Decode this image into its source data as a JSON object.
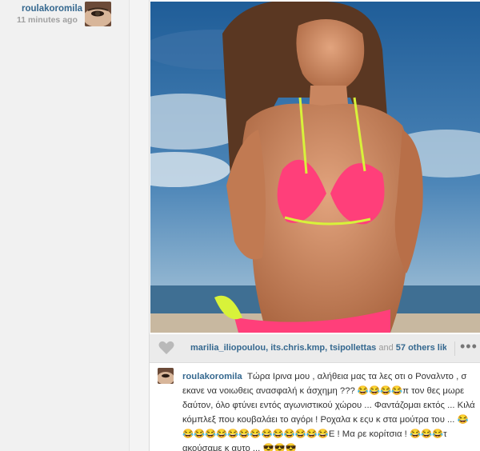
{
  "post": {
    "username": "roulakoromila",
    "time": "11 minutes ago"
  },
  "likes": {
    "users": [
      "marilia_iliopoulou",
      "its.chris.kmp",
      "tsipollettas"
    ],
    "and_text": "and",
    "others": "57 others lik..."
  },
  "comment": {
    "username": "roulakoromila",
    "text": "Τώρα Ιρινα μου , αλήθεια μας τα λες οτι ο Ροναλντο , σ εκανε να νοιωθεις ανασφαλή κ άσχημη ??? 😂😂😂😂π τον θες μωρε δαύτον, όλο φτύνει εντός αγωνιστικού χώρου ... Φαντάζομαι εκτός ... Κιλά κόμπλεξ που κουβαλάει το αγόρι ! Ροχαλα κ εςυ κ στα μούτρα του ... 😂😂😂😂😂😂😂😂😂😂😂😂😂😂Ε ! Μα ρε κορίτσια ! 😂😂😂τ ακούσαμε κ αυτο ... 😎😎😎"
  },
  "icons": {
    "heart": "heart-icon",
    "more": "more-options-icon"
  },
  "colors": {
    "link": "#35688f",
    "muted": "#999999",
    "background": "#f4f4f4"
  }
}
